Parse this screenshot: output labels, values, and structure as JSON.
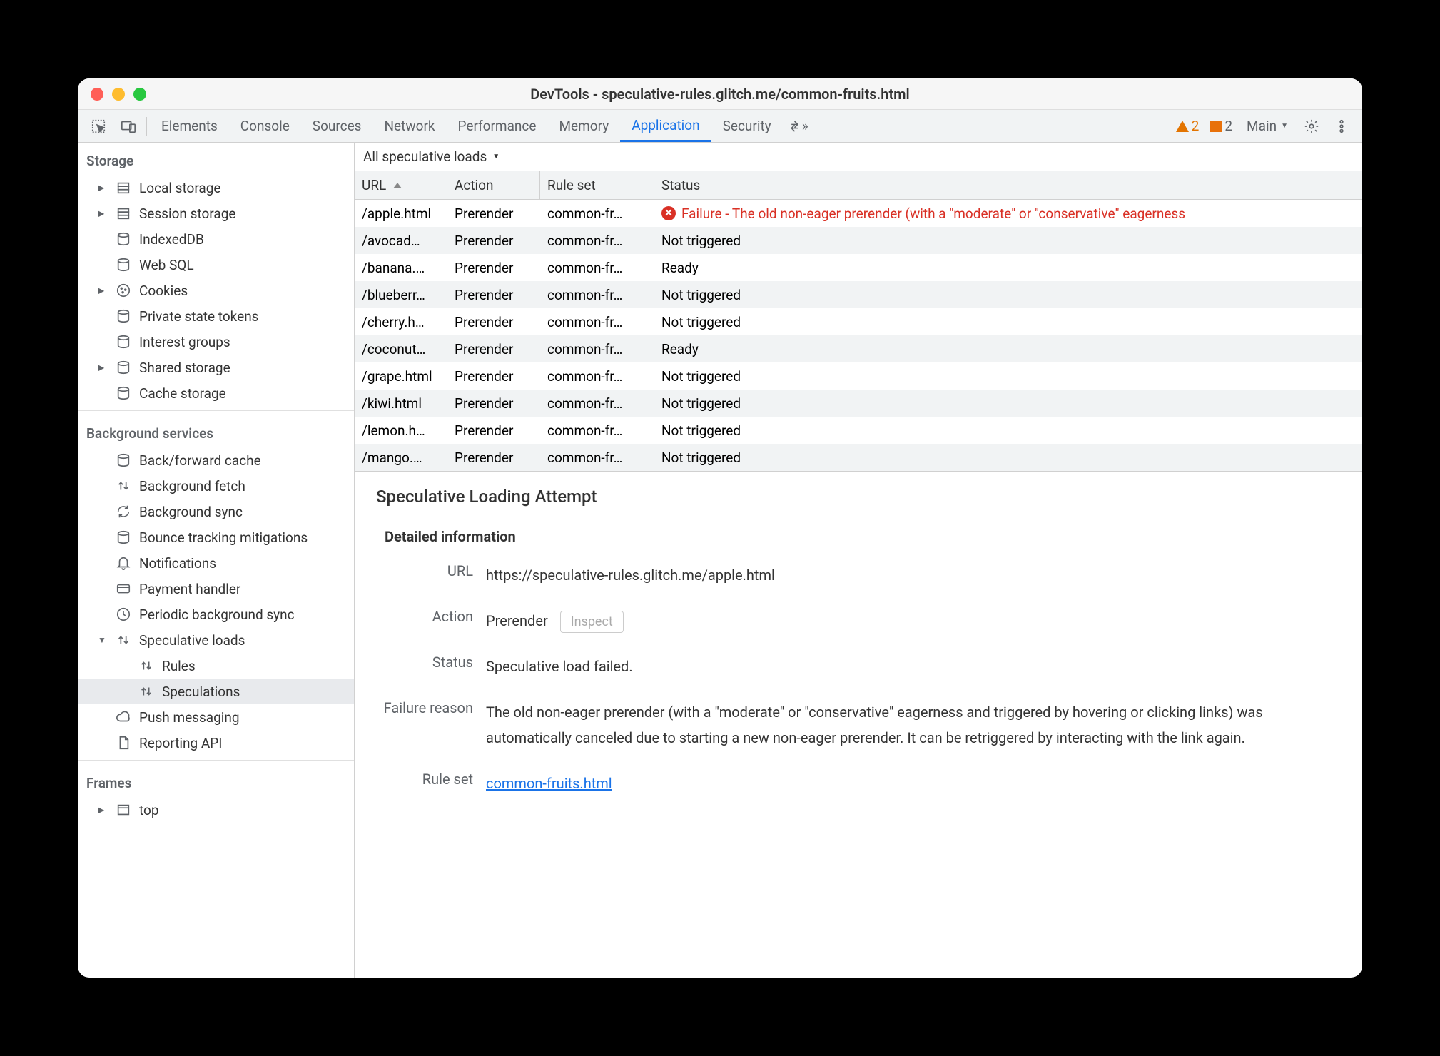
{
  "title": "DevTools - speculative-rules.glitch.me/common-fruits.html",
  "tabs": [
    "Elements",
    "Console",
    "Sources",
    "Network",
    "Performance",
    "Memory",
    "Application",
    "Security"
  ],
  "activeTab": "Application",
  "warnCount": "2",
  "errCount": "2",
  "target": "Main",
  "sidebar": {
    "storage": {
      "header": "Storage",
      "items": [
        {
          "icon": "db",
          "label": "Local storage",
          "expand": true
        },
        {
          "icon": "db",
          "label": "Session storage",
          "expand": true
        },
        {
          "icon": "cyl",
          "label": "IndexedDB"
        },
        {
          "icon": "cyl",
          "label": "Web SQL"
        },
        {
          "icon": "cookie",
          "label": "Cookies",
          "expand": true
        },
        {
          "icon": "cyl",
          "label": "Private state tokens"
        },
        {
          "icon": "cyl",
          "label": "Interest groups"
        },
        {
          "icon": "cyl",
          "label": "Shared storage",
          "expand": true
        },
        {
          "icon": "cyl",
          "label": "Cache storage"
        }
      ]
    },
    "bg": {
      "header": "Background services",
      "items": [
        {
          "icon": "cyl",
          "label": "Back/forward cache"
        },
        {
          "icon": "updown",
          "label": "Background fetch"
        },
        {
          "icon": "sync",
          "label": "Background sync"
        },
        {
          "icon": "cyl",
          "label": "Bounce tracking mitigations"
        },
        {
          "icon": "bell",
          "label": "Notifications"
        },
        {
          "icon": "card",
          "label": "Payment handler"
        },
        {
          "icon": "clock",
          "label": "Periodic background sync"
        },
        {
          "icon": "updown",
          "label": "Speculative loads",
          "expand": true,
          "open": true
        },
        {
          "icon": "updown",
          "label": "Rules",
          "sub": true
        },
        {
          "icon": "updown",
          "label": "Speculations",
          "sub": true,
          "selected": true
        },
        {
          "icon": "cloud",
          "label": "Push messaging"
        },
        {
          "icon": "doc",
          "label": "Reporting API"
        }
      ]
    },
    "frames": {
      "header": "Frames",
      "items": [
        {
          "icon": "frame",
          "label": "top",
          "expand": true
        }
      ]
    }
  },
  "filter": "All speculative loads",
  "columns": [
    "URL",
    "Action",
    "Rule set",
    "Status"
  ],
  "rows": [
    {
      "url": "/apple.html",
      "action": "Prerender",
      "rule": "common-fr…",
      "status": "Failure - The old non-eager prerender (with a \"moderate\" or \"conservative\" eagerness",
      "error": true
    },
    {
      "url": "/avocad…",
      "action": "Prerender",
      "rule": "common-fr…",
      "status": "Not triggered"
    },
    {
      "url": "/banana.…",
      "action": "Prerender",
      "rule": "common-fr…",
      "status": "Ready"
    },
    {
      "url": "/blueberr…",
      "action": "Prerender",
      "rule": "common-fr…",
      "status": "Not triggered"
    },
    {
      "url": "/cherry.h…",
      "action": "Prerender",
      "rule": "common-fr…",
      "status": "Not triggered"
    },
    {
      "url": "/coconut…",
      "action": "Prerender",
      "rule": "common-fr…",
      "status": "Ready"
    },
    {
      "url": "/grape.html",
      "action": "Prerender",
      "rule": "common-fr…",
      "status": "Not triggered"
    },
    {
      "url": "/kiwi.html",
      "action": "Prerender",
      "rule": "common-fr…",
      "status": "Not triggered"
    },
    {
      "url": "/lemon.h…",
      "action": "Prerender",
      "rule": "common-fr…",
      "status": "Not triggered"
    },
    {
      "url": "/mango.…",
      "action": "Prerender",
      "rule": "common-fr…",
      "status": "Not triggered"
    }
  ],
  "details": {
    "title": "Speculative Loading Attempt",
    "section": "Detailed information",
    "urlLabel": "URL",
    "url": "https://speculative-rules.glitch.me/apple.html",
    "actionLabel": "Action",
    "action": "Prerender",
    "inspect": "Inspect",
    "statusLabel": "Status",
    "status": "Speculative load failed.",
    "reasonLabel": "Failure reason",
    "reason": "The old non-eager prerender (with a \"moderate\" or \"conservative\" eagerness and triggered by hovering or clicking links) was automatically canceled due to starting a new non-eager prerender. It can be retriggered by interacting with the link again.",
    "rulesetLabel": "Rule set",
    "ruleset": "common-fruits.html"
  }
}
